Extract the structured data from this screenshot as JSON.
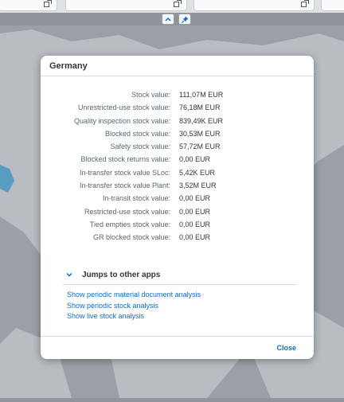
{
  "header": {
    "tiles": [
      {
        "name": "tile-left",
        "icon": "expand-icon"
      },
      {
        "name": "tile-middle",
        "icon": "expand-icon"
      },
      {
        "name": "tile-right",
        "icon": "expand-icon"
      }
    ],
    "collapse_icon": "chevron-up-icon",
    "pin_icon": "pin-icon"
  },
  "dialog": {
    "title": "Germany",
    "rows": [
      {
        "label": "Stock value:",
        "value": "111,07M EUR"
      },
      {
        "label": "Unrestricted-use stock value:",
        "value": "76,18M EUR"
      },
      {
        "label": "Quality inspection stock value:",
        "value": "839,49K EUR"
      },
      {
        "label": "Blocked stock value:",
        "value": "30,53M EUR"
      },
      {
        "label": "Safety stock value:",
        "value": "57,72M EUR"
      },
      {
        "label": "Blocked stock returns value:",
        "value": "0,00 EUR"
      },
      {
        "label": "In-transfer stock value SLoc:",
        "value": "5,42K EUR"
      },
      {
        "label": "In-transfer stock value Plant:",
        "value": "3,52M EUR"
      },
      {
        "label": "In-transit stock value:",
        "value": "0,00 EUR"
      },
      {
        "label": "Restricted-use stock value:",
        "value": "0,00 EUR"
      },
      {
        "label": "Tied empties stock value:",
        "value": "0,00 EUR"
      },
      {
        "label": "GR blocked stock value:",
        "value": "0,00 EUR"
      }
    ],
    "jumps": {
      "title": "Jumps to other apps",
      "links": [
        "Show periodic material document analysis",
        "Show periodic stock analysis",
        "Show live stock analysis"
      ]
    },
    "close_label": "Close"
  },
  "colors": {
    "link": "#0a6ed1",
    "map": "#9aa0a6",
    "land": "#b9bdc1"
  }
}
